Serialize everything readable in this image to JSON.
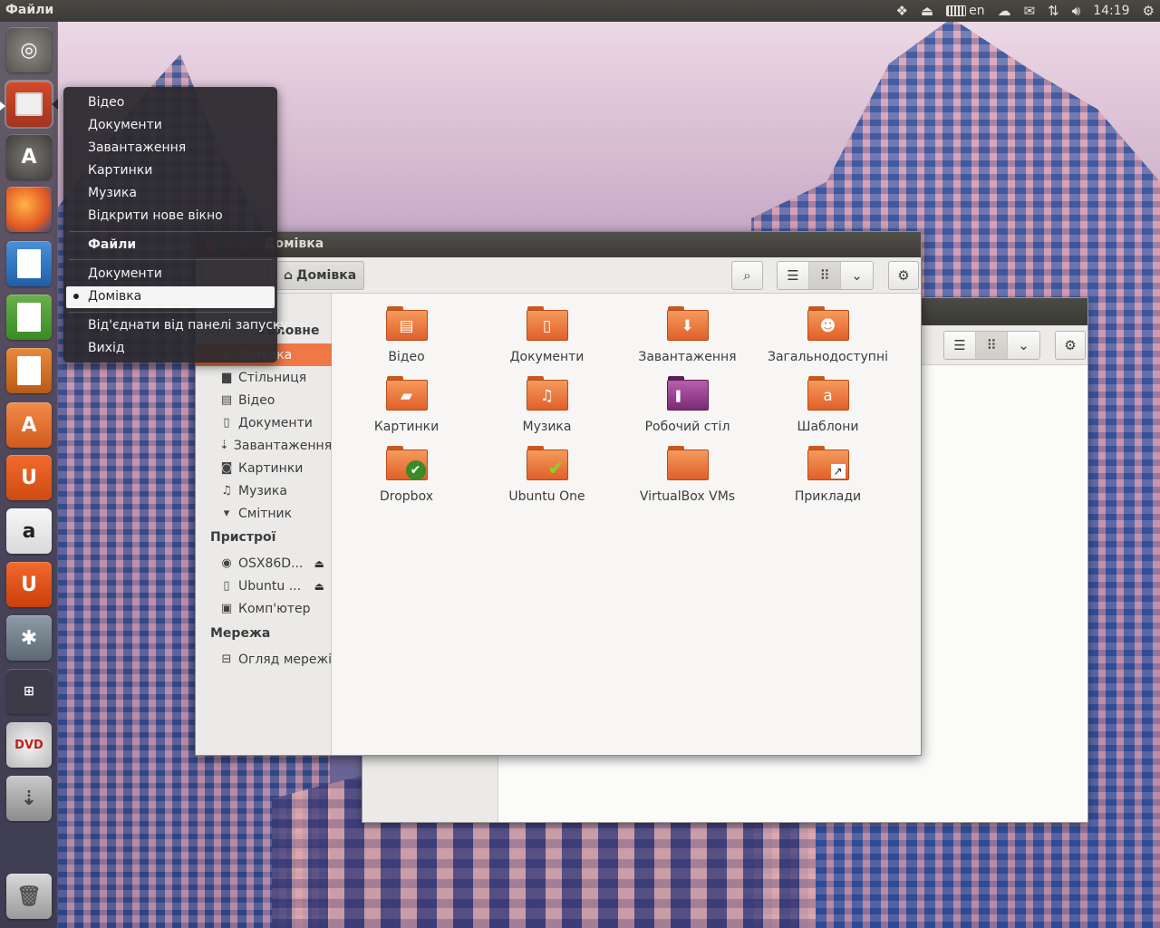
{
  "top_panel": {
    "app_title": "Файли",
    "keyboard_layout": "en",
    "clock": "14:19",
    "indicators": [
      "dropbox-icon",
      "eject-icon",
      "keyboard-icon",
      "cloud-icon",
      "mail-icon",
      "network-icon",
      "volume-icon",
      "gear-icon"
    ]
  },
  "launcher": {
    "items": [
      {
        "name": "dash-home",
        "icon": "ubuntu-logo-icon"
      },
      {
        "name": "files",
        "icon": "file-cabinet-icon",
        "active": true
      },
      {
        "name": "software-updater",
        "icon": "updater-icon"
      },
      {
        "name": "firefox",
        "icon": "firefox-icon"
      },
      {
        "name": "libreoffice-writer",
        "icon": "writer-icon"
      },
      {
        "name": "libreoffice-calc",
        "icon": "calc-icon"
      },
      {
        "name": "libreoffice-impress",
        "icon": "impress-icon"
      },
      {
        "name": "ubuntu-software-center",
        "icon": "software-center-icon"
      },
      {
        "name": "ubuntu-one",
        "icon": "ubuntu-one-icon"
      },
      {
        "name": "amazon",
        "icon": "amazon-icon"
      },
      {
        "name": "ubuntu-one-music",
        "icon": "music-store-icon"
      },
      {
        "name": "system-settings",
        "icon": "settings-icon"
      },
      {
        "name": "workspace-switcher",
        "icon": "workspaces-icon"
      },
      {
        "name": "dvd-drive",
        "icon": "dvd-icon"
      },
      {
        "name": "usb-drive",
        "icon": "usb-icon"
      },
      {
        "name": "trash",
        "icon": "trash-icon"
      }
    ]
  },
  "quicklist": {
    "items_top": [
      "Відео",
      "Документи",
      "Завантаження",
      "Картинки",
      "Музика",
      "Відкрити нове вікно"
    ],
    "header": "Файли",
    "windows": [
      "Документи",
      "Домівка"
    ],
    "selected_window": "Домівка",
    "items_bottom": [
      "Від'єднати від панелі запуску",
      "Вихід"
    ]
  },
  "window": {
    "title": "Домівка",
    "breadcrumb": "Домівка",
    "sidebar": {
      "places_head_partial": "Головне",
      "places": [
        {
          "label": "Домівка",
          "icon": "home-icon"
        },
        {
          "label": "Стільниця",
          "icon": "folder-icon"
        },
        {
          "label": "Відео",
          "icon": "film-icon"
        },
        {
          "label": "Документи",
          "icon": "document-icon"
        },
        {
          "label": "Завантаження",
          "icon": "download-icon"
        },
        {
          "label": "Картинки",
          "icon": "camera-icon"
        },
        {
          "label": "Музика",
          "icon": "music-note-icon"
        },
        {
          "label": "Смітник",
          "icon": "trash-icon"
        }
      ],
      "devices_head": "Пристрої",
      "devices": [
        {
          "label": "OSX86D...",
          "icon": "disc-icon"
        },
        {
          "label": "Ubuntu ...",
          "icon": "usb-drive-icon"
        },
        {
          "label": "Комп'ютер",
          "icon": "computer-icon"
        }
      ],
      "network_head": "Мережа",
      "network": [
        {
          "label": "Огляд мережі",
          "icon": "network-icon"
        }
      ]
    },
    "folders": [
      {
        "label": "Відео",
        "emblem": "film-icon"
      },
      {
        "label": "Документи",
        "emblem": "document-icon"
      },
      {
        "label": "Завантаження",
        "emblem": "download-icon"
      },
      {
        "label": "Загальнодоступні",
        "emblem": "person-icon"
      },
      {
        "label": "Картинки",
        "emblem": "picture-icon"
      },
      {
        "label": "Музика",
        "emblem": "music-note-icon"
      },
      {
        "label": "Робочий стіл",
        "emblem": "desktop-icon"
      },
      {
        "label": "Шаблони",
        "emblem": "template-icon"
      },
      {
        "label": "Dropbox",
        "emblem": "check-badge-icon"
      },
      {
        "label": "Ubuntu One",
        "emblem": "check-mark-icon"
      },
      {
        "label": "VirtualBox VMs",
        "emblem": "none"
      },
      {
        "label": "Приклади",
        "emblem": "link-arrow-icon"
      }
    ]
  },
  "colors": {
    "accent": "#f07746",
    "panel": "#3c3b37",
    "folder": "#e8703a"
  }
}
